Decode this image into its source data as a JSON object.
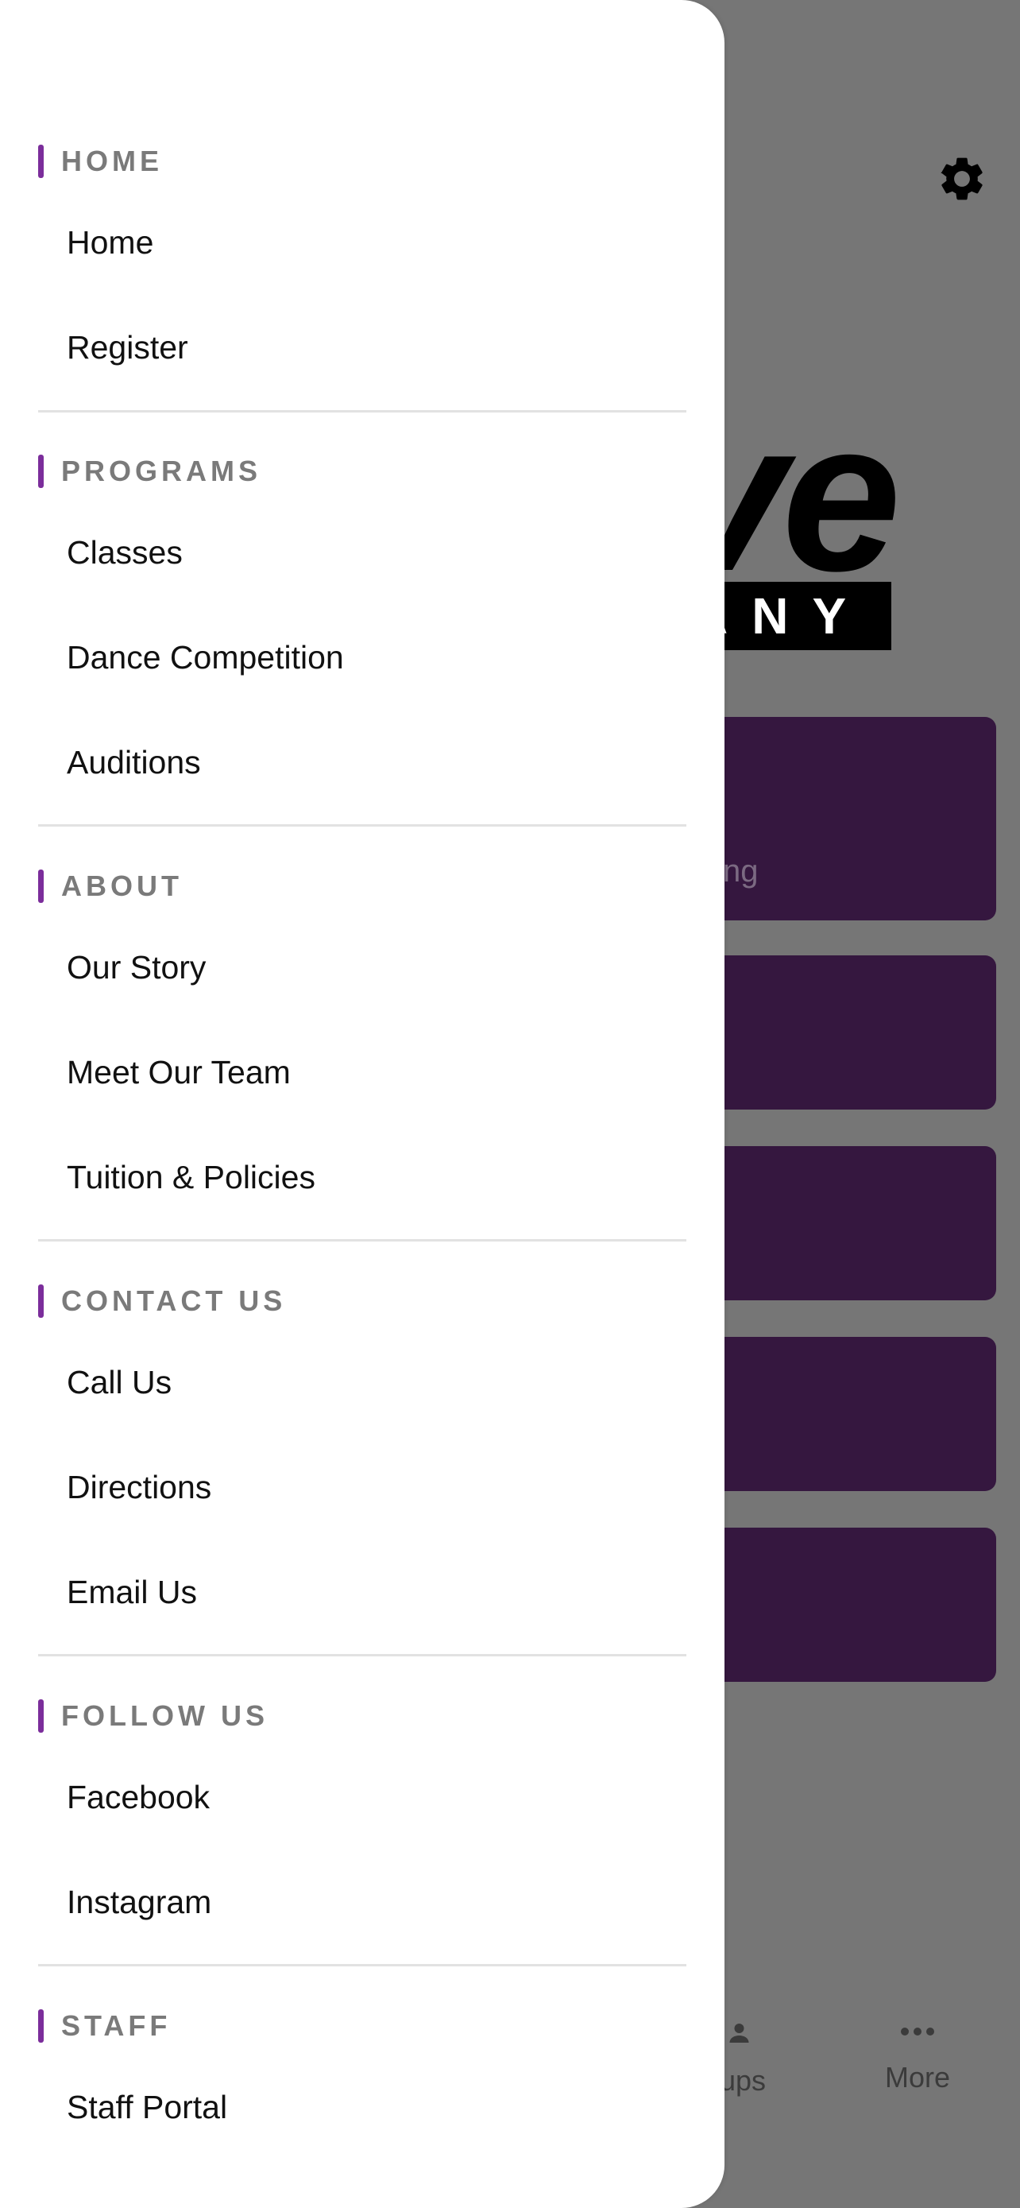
{
  "background": {
    "logo_main": "ve",
    "logo_sub": "ANY",
    "card_partial_text": "ng",
    "tabbar": {
      "partial_label": "ups",
      "more_label": "More"
    }
  },
  "drawer": {
    "accent_color": "#7b2d9b",
    "sections": [
      {
        "title": "HOME",
        "items": [
          "Home",
          "Register"
        ]
      },
      {
        "title": "PROGRAMS",
        "items": [
          "Classes",
          "Dance Competition",
          "Auditions"
        ]
      },
      {
        "title": "ABOUT",
        "items": [
          "Our Story",
          "Meet Our Team",
          "Tuition & Policies"
        ]
      },
      {
        "title": "CONTACT US",
        "items": [
          "Call Us",
          "Directions",
          "Email Us"
        ]
      },
      {
        "title": "FOLLOW US",
        "items": [
          "Facebook",
          "Instagram"
        ]
      },
      {
        "title": "STAFF",
        "items": [
          "Staff Portal"
        ]
      }
    ]
  }
}
